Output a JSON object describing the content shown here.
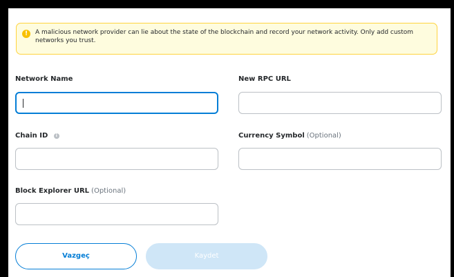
{
  "warning": {
    "icon": "warning-icon",
    "text": "A malicious network provider can lie about the state of the blockchain and record your network activity. Only add custom networks you trust."
  },
  "form": {
    "network_name": {
      "label": "Network Name",
      "value": ""
    },
    "rpc_url": {
      "label": "New RPC URL",
      "value": ""
    },
    "chain_id": {
      "label": "Chain ID",
      "value": ""
    },
    "currency_symbol": {
      "label": "Currency Symbol",
      "optional": "(Optional)",
      "value": ""
    },
    "block_explorer": {
      "label": "Block Explorer URL",
      "optional": "(Optional)",
      "value": ""
    }
  },
  "actions": {
    "cancel_label": "Vazgeç",
    "save_label": "Kaydet"
  },
  "colors": {
    "primary": "#037dd6",
    "warning_bg": "#fefcde",
    "warning_border": "#ffd33d",
    "disabled_button": "#cfe6f7"
  }
}
